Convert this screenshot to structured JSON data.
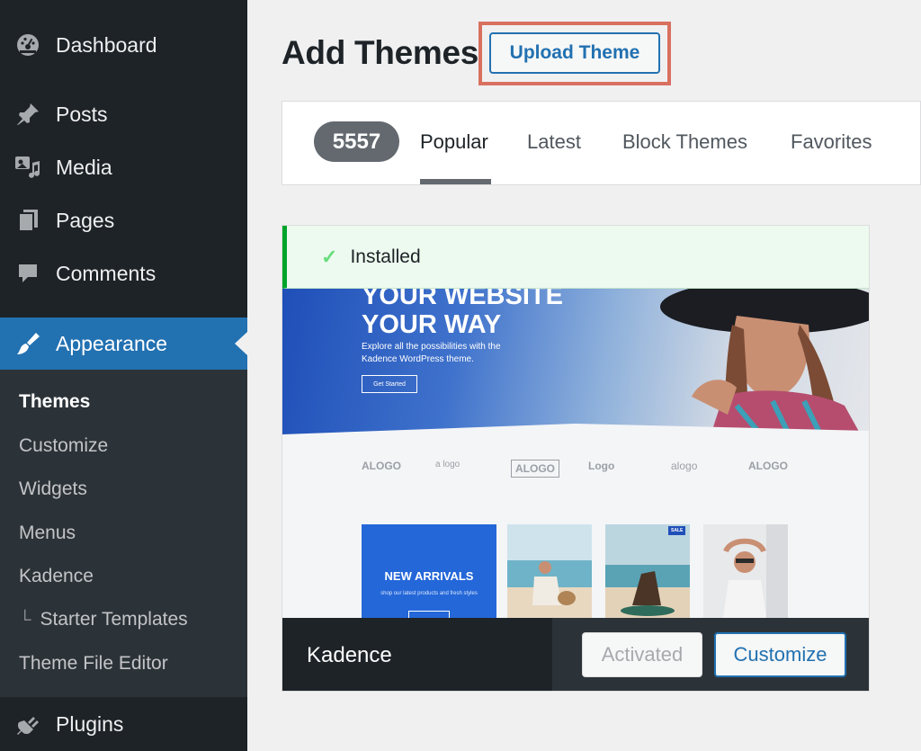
{
  "sidebar": {
    "items": [
      {
        "label": "Dashboard",
        "icon": "dashboard-icon"
      },
      {
        "label": "Posts",
        "icon": "pushpin-icon"
      },
      {
        "label": "Media",
        "icon": "media-icon"
      },
      {
        "label": "Pages",
        "icon": "pages-icon"
      },
      {
        "label": "Comments",
        "icon": "comment-icon"
      },
      {
        "label": "Appearance",
        "icon": "paintbrush-icon"
      },
      {
        "label": "Plugins",
        "icon": "plugin-icon"
      }
    ],
    "submenu": [
      {
        "label": "Themes"
      },
      {
        "label": "Customize"
      },
      {
        "label": "Widgets"
      },
      {
        "label": "Menus"
      },
      {
        "label": "Kadence"
      },
      {
        "label": "Starter Templates",
        "prefix": "└"
      },
      {
        "label": "Theme File Editor"
      }
    ]
  },
  "header": {
    "title": "Add Themes",
    "upload_button": "Upload Theme"
  },
  "filter": {
    "count": "5557",
    "tabs": [
      "Popular",
      "Latest",
      "Block Themes",
      "Favorites"
    ]
  },
  "theme": {
    "status": "Installed",
    "preview": {
      "hero_title_1": "YOUR WEBSITE",
      "hero_title_2": "YOUR WAY",
      "hero_sub": "Explore all the possibilities with the Kadence WordPress theme.",
      "hero_button": "Get Started",
      "logos": [
        "ALOGO",
        "a logo",
        "ALOGO",
        "Logo",
        "alogo",
        "ALOGO"
      ],
      "promo_title": "NEW ARRIVALS",
      "promo_sub": "shop our latest products and fresh styles",
      "sale_badge": "SALE"
    },
    "name": "Kadence",
    "activated_label": "Activated",
    "customize_label": "Customize"
  },
  "colors": {
    "sidebar_bg": "#1d2327",
    "submenu_bg": "#2c3338",
    "accent": "#2271b1",
    "highlight": "#d9705f",
    "success": "#00a32a"
  }
}
